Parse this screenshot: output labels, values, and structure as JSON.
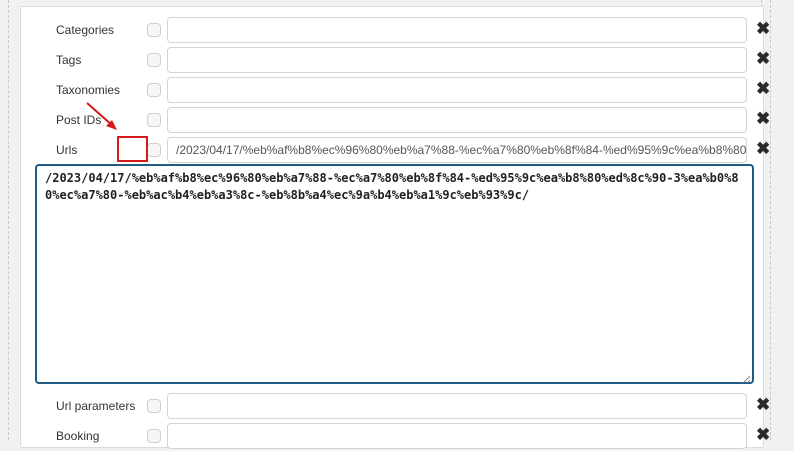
{
  "rows": [
    {
      "label": "Categories",
      "value": ""
    },
    {
      "label": "Tags",
      "value": ""
    },
    {
      "label": "Taxonomies",
      "value": ""
    },
    {
      "label": "Post IDs",
      "value": ""
    },
    {
      "label": "Urls",
      "value": "/2023/04/17/%eb%af%b8%ec%96%80%eb%a7%88-%ec%a7%80%eb%8f%84-%ed%95%9c%ea%b8%80"
    },
    {
      "label": "Url parameters",
      "value": ""
    },
    {
      "label": "Booking",
      "value": ""
    }
  ],
  "urls_textarea": {
    "value": "/2023/04/17/%eb%af%b8%ec%96%80%eb%a7%88-%ec%a7%80%eb%8f%84-%ed%95%9c%ea%b8%80%ed%8c%90-3%ea%b0%80%ec%a7%80-%eb%ac%b4%eb%a3%8c-%eb%8b%a4%ec%9a%b4%eb%a1%9c%eb%93%9c/"
  },
  "icons": {
    "remove": "close-icon",
    "pointer": "red-arrow"
  },
  "colors": {
    "highlight": "#d41a1a",
    "textarea_border": "#1f5c82"
  }
}
